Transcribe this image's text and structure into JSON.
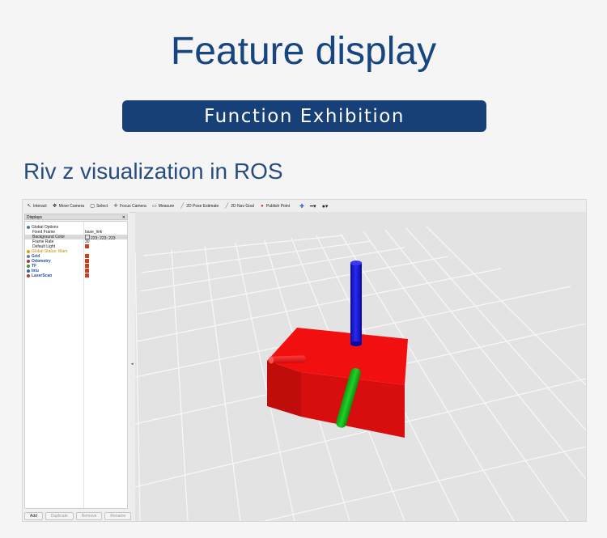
{
  "header": {
    "title": "Feature display",
    "banner": "Function Exhibition",
    "subtitle": "Riv z visualization in ROS"
  },
  "rviz": {
    "toolbar": [
      {
        "label": "Interact",
        "icon": "interact-icon"
      },
      {
        "label": "Move Camera",
        "icon": "move-camera-icon"
      },
      {
        "label": "Select",
        "icon": "select-icon"
      },
      {
        "label": "Focus Camera",
        "icon": "focus-camera-icon"
      },
      {
        "label": "Measure",
        "icon": "measure-icon"
      },
      {
        "label": "2D Pose Estimate",
        "icon": "pose-estimate-icon"
      },
      {
        "label": "2D Nav Goal",
        "icon": "nav-goal-icon"
      },
      {
        "label": "Publish Point",
        "icon": "publish-point-icon"
      }
    ],
    "displays_title": "Displays",
    "global_options": "Global Options",
    "fixed_frame_label": "Fixed Frame",
    "fixed_frame_value": "base_link",
    "background_color_label": "Background Color",
    "background_color_value": "223; 223; 223",
    "frame_rate_label": "Frame Rate",
    "frame_rate_value": "30",
    "default_light_label": "Default Light",
    "global_status": "Global Status: Warn",
    "displays": [
      "Grid",
      "Odometry",
      "TF",
      "Imu",
      "LaserScan"
    ],
    "buttons": {
      "add": "Add",
      "duplicate": "Duplicate",
      "remove": "Remove",
      "rename": "Rename"
    },
    "colors": {
      "box": "#e01212",
      "x_axis": "#e01212",
      "y_axis": "#12b818",
      "z_axis": "#1212cc",
      "grid_bg": "#e3e3e3"
    }
  }
}
